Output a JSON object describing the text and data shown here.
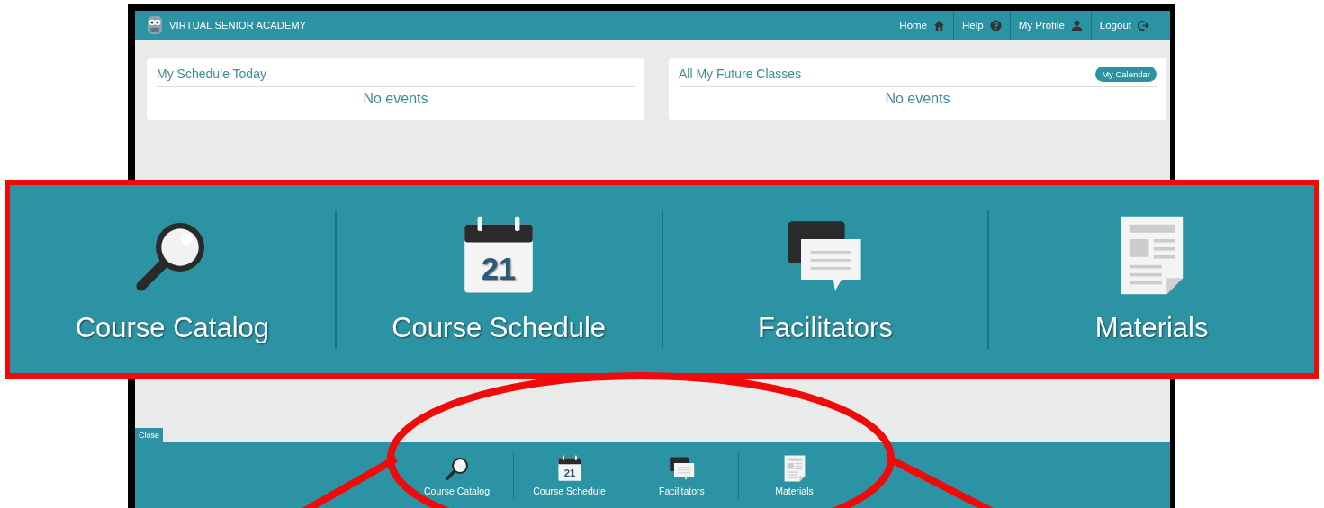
{
  "header": {
    "brand": "VIRTUAL SENIOR ACADEMY",
    "nav": [
      {
        "label": "Home",
        "kind": "home"
      },
      {
        "label": "Help",
        "kind": "help"
      },
      {
        "label": "My Profile",
        "kind": "profile"
      },
      {
        "label": "Logout",
        "kind": "logout"
      }
    ]
  },
  "cards": [
    {
      "title": "My Schedule Today",
      "message": "No events"
    },
    {
      "title": "All My Future Classes",
      "message": "No events",
      "button": "My Calendar"
    }
  ],
  "close_tab": "Close",
  "dock": [
    {
      "label": "Course Catalog",
      "kind": "search"
    },
    {
      "label": "Course Schedule",
      "kind": "calendar",
      "icon_text": "21"
    },
    {
      "label": "Facilitators",
      "kind": "chat"
    },
    {
      "label": "Materials",
      "kind": "document"
    }
  ],
  "callout": [
    {
      "label": "Course Catalog",
      "kind": "search"
    },
    {
      "label": "Course Schedule",
      "kind": "calendar",
      "icon_text": "21"
    },
    {
      "label": "Facilitators",
      "kind": "chat"
    },
    {
      "label": "Materials",
      "kind": "document"
    }
  ]
}
